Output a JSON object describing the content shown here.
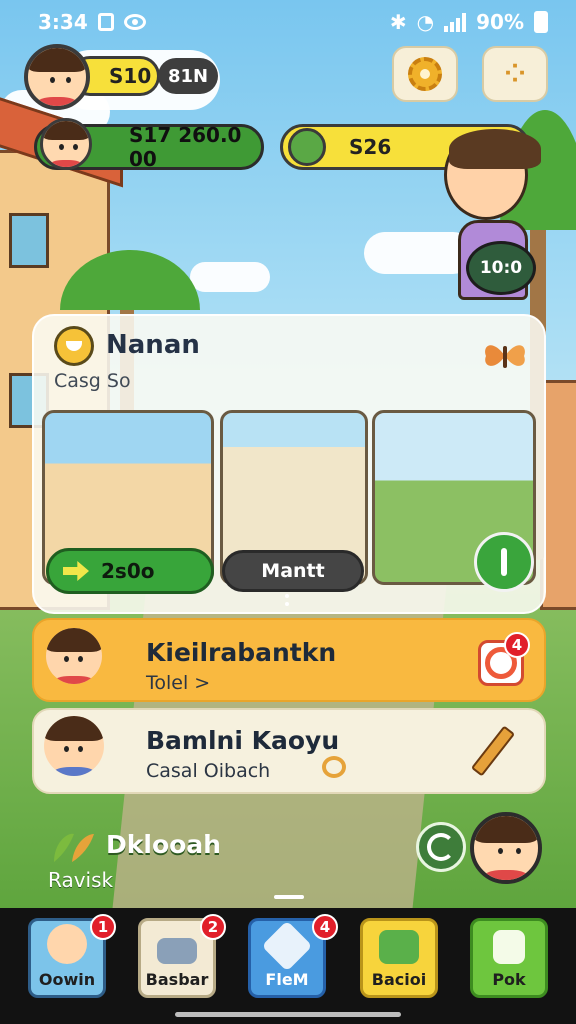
{
  "status_bar": {
    "time": "3:34",
    "battery": "90%"
  },
  "hud": {
    "coins": "S10",
    "level": "81N",
    "balance": "S17 260.0 00",
    "gems": "S26",
    "timer": "10:0"
  },
  "panel": {
    "title": "Nanan",
    "subtitle": "Casg So",
    "play_label": "2s0o",
    "market_label": "Mantt"
  },
  "rows": [
    {
      "title": "Kieilrabantkn",
      "subtitle": "Tolel >",
      "badge": "4"
    },
    {
      "title": "Bamlni Kaoyu",
      "subtitle": "Casal Oibach"
    }
  ],
  "bottom": {
    "title": "Dklooah",
    "subtitle": "Ravisk"
  },
  "nav": [
    {
      "label": "Oowin",
      "badge": "1"
    },
    {
      "label": "Basbar",
      "badge": "2"
    },
    {
      "label": "FleM",
      "badge": "4"
    },
    {
      "label": "Bacioi"
    },
    {
      "label": "Pok"
    }
  ],
  "colors": {
    "accent_yellow": "#f7e03a",
    "accent_green": "#38a53a",
    "accent_orange": "#f9b940",
    "badge_red": "#e11f2a",
    "nav_background": "#121212"
  },
  "icons": {
    "settings": "gear-icon",
    "more": "dots-grid-icon",
    "notifications": "bell-icon",
    "edit": "pencil-icon",
    "decoration": "butterfly-icon"
  }
}
